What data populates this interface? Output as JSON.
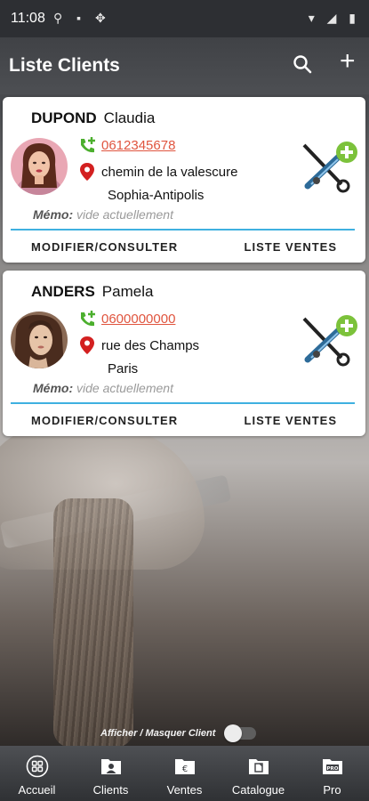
{
  "status_bar": {
    "time": "11:08"
  },
  "app_bar": {
    "title": "Liste Clients"
  },
  "clients": [
    {
      "last_name": "DUPOND",
      "first_name": "Claudia",
      "phone": "0612345678",
      "street": "chemin de la valescure",
      "city": "Sophia-Antipolis",
      "memo_label": "Mémo:",
      "memo_value": "vide actuellement",
      "edit_label": "MODIFIER/CONSULTER",
      "sales_label": "LISTE VENTES"
    },
    {
      "last_name": "ANDERS",
      "first_name": "Pamela",
      "phone": "0600000000",
      "street": "rue des Champs",
      "city": "Paris",
      "memo_label": "Mémo:",
      "memo_value": "vide actuellement",
      "edit_label": "MODIFIER/CONSULTER",
      "sales_label": "LISTE VENTES"
    }
  ],
  "toggle": {
    "label": "Afficher / Masquer Client"
  },
  "bottom_nav": [
    {
      "label": "Accueil",
      "icon": "grid-icon"
    },
    {
      "label": "Clients",
      "icon": "clients-icon"
    },
    {
      "label": "Ventes",
      "icon": "sales-icon"
    },
    {
      "label": "Catalogue",
      "icon": "catalogue-icon"
    },
    {
      "label": "Pro",
      "icon": "pro-icon"
    }
  ],
  "colors": {
    "accent": "#3fb0e0",
    "phone_link": "#e0553f",
    "phone_icon": "#4caf2e",
    "pin": "#d32020"
  }
}
